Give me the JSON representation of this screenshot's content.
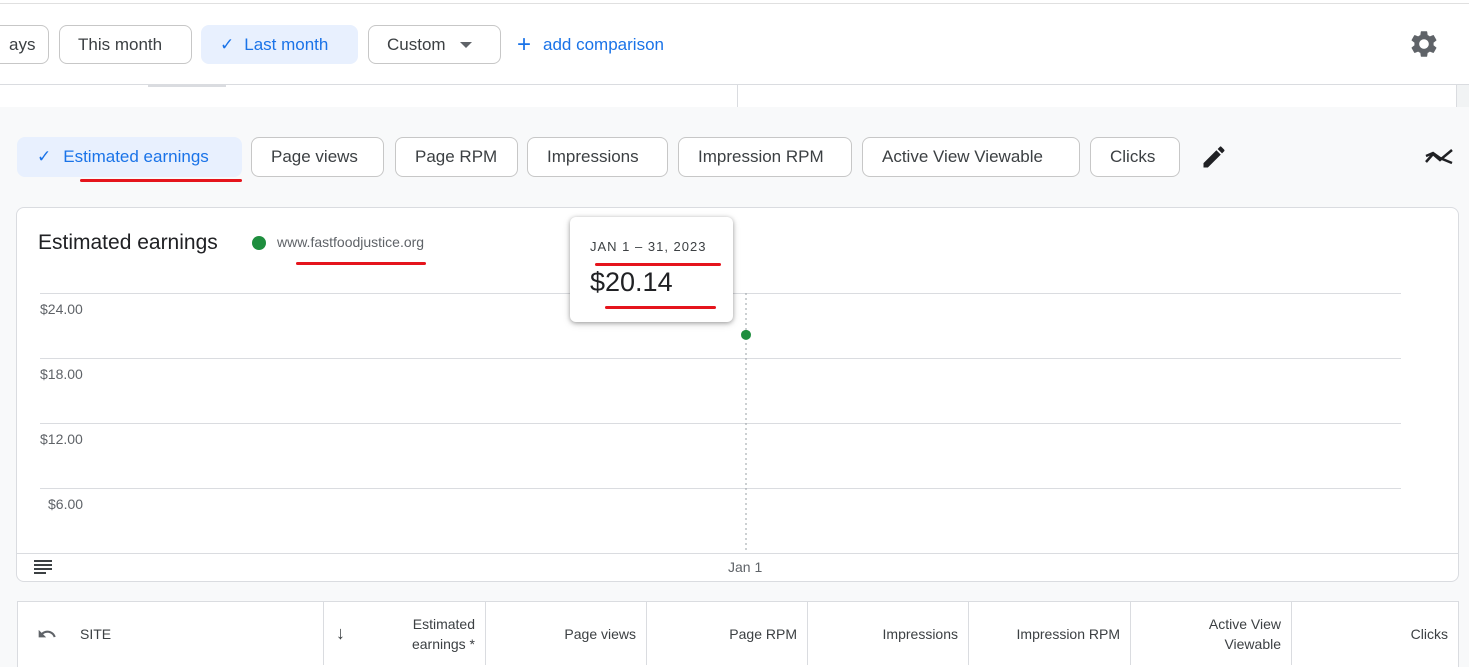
{
  "filters": {
    "partial_chip": "ays",
    "this_month": "This month",
    "last_month": "Last month",
    "custom": "Custom",
    "add_comparison": "add comparison"
  },
  "metrics": [
    {
      "label": "Estimated earnings",
      "selected": true
    },
    {
      "label": "Page views",
      "selected": false
    },
    {
      "label": "Page RPM",
      "selected": false
    },
    {
      "label": "Impressions",
      "selected": false
    },
    {
      "label": "Impression RPM",
      "selected": false
    },
    {
      "label": "Active View Viewable",
      "selected": false
    },
    {
      "label": "Clicks",
      "selected": false
    }
  ],
  "chart": {
    "title": "Estimated earnings",
    "legend": "www.fastfoodjustice.org",
    "tooltip_date": "JAN 1 – 31, 2023",
    "tooltip_value": "$20.14"
  },
  "chart_data": {
    "type": "line",
    "title": "Estimated earnings",
    "xlabel": "",
    "ylabel": "",
    "x": [
      "Jan 1"
    ],
    "series": [
      {
        "name": "www.fastfoodjustice.org",
        "values": [
          20.14
        ],
        "color": "#1e8e3e"
      }
    ],
    "y_ticks": [
      "$24.00",
      "$18.00",
      "$12.00",
      "$6.00"
    ],
    "ylim": [
      0,
      24
    ],
    "grid": true
  },
  "table": {
    "site_header": "SITE",
    "earnings_header_1": "Estimated",
    "earnings_header_2": "earnings *",
    "page_views": "Page views",
    "page_rpm": "Page RPM",
    "impressions": "Impressions",
    "impression_rpm": "Impression RPM",
    "active_view_1": "Active View",
    "active_view_2": "Viewable",
    "clicks": "Clicks"
  },
  "colors": {
    "accent": "#1a73e8",
    "series": "#1e8e3e",
    "annotation": "#e5141c"
  }
}
